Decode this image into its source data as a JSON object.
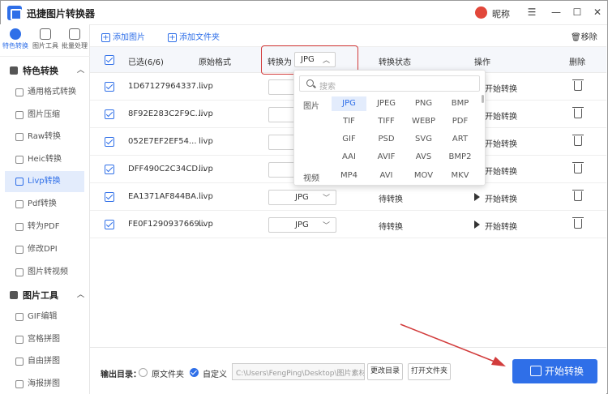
{
  "app": {
    "title": "迅捷图片转换器",
    "nickname": "昵称"
  },
  "window": {
    "menu": "☰",
    "minimize": "—",
    "maximize": "☐",
    "close": "✕"
  },
  "sidebar": {
    "top_tabs": [
      "特色转换",
      "图片工具",
      "批量处理"
    ],
    "sections": [
      {
        "title": "特色转换",
        "items": [
          "通用格式转换",
          "图片压缩",
          "Raw转换",
          "Heic转换",
          "Livp转换",
          "Pdf转换",
          "转为PDF",
          "修改DPI",
          "图片转视频"
        ]
      },
      {
        "title": "图片工具",
        "items": [
          "GIF编辑",
          "宫格拼图",
          "自由拼图",
          "海报拼图"
        ]
      }
    ],
    "active_item": "Livp转换"
  },
  "toolbar": {
    "add_image": "添加图片",
    "add_folder": "添加文件夹",
    "remove": "移除"
  },
  "table": {
    "headers": {
      "selected": "已选(6/6)",
      "orig": "原始格式",
      "convert_to": "转换为",
      "convert_to_value": "JPG",
      "status": "转换状态",
      "action": "操作",
      "delete": "删除"
    },
    "rows": [
      {
        "name": "1D67127964337...",
        "fmt": "livp",
        "target": "",
        "status": "",
        "action": "开始转换"
      },
      {
        "name": "8F92E283C2F9C...",
        "fmt": "livp",
        "target": "",
        "status": "",
        "action": "开始转换"
      },
      {
        "name": "052E7EF2EF54...",
        "fmt": "livp",
        "target": "",
        "status": "",
        "action": "开始转换"
      },
      {
        "name": "DFF490C2C34CD...",
        "fmt": "livp",
        "target": "",
        "status": "",
        "action": "开始转换"
      },
      {
        "name": "EA1371AF844BA...",
        "fmt": "livp",
        "target": "JPG",
        "status": "待转换",
        "action": "开始转换"
      },
      {
        "name": "FE0F1290937669...",
        "fmt": "livp",
        "target": "JPG",
        "status": "待转换",
        "action": "开始转换"
      }
    ]
  },
  "popup": {
    "search_placeholder": "搜索",
    "image_label": "图片",
    "video_label": "视频",
    "image_formats": [
      "JPG",
      "JPEG",
      "PNG",
      "BMP",
      "TIF",
      "TIFF",
      "WEBP",
      "PDF",
      "GIF",
      "PSD",
      "SVG",
      "ART",
      "AAI",
      "AVIF",
      "AVS",
      "BMP2"
    ],
    "video_formats": [
      "MP4",
      "AVI",
      "MOV",
      "MKV"
    ],
    "selected": "JPG"
  },
  "output": {
    "label": "输出目录：",
    "option_source": "原文件夹",
    "option_custom": "自定义",
    "path": "C:\\Users\\FengPing\\Desktop\\图片素材",
    "change_dir": "更改目录",
    "open_folder": "打开文件夹",
    "start": "开始转换"
  },
  "colors": {
    "accent": "#2f6fe8",
    "highlight": "#d23c3c"
  }
}
